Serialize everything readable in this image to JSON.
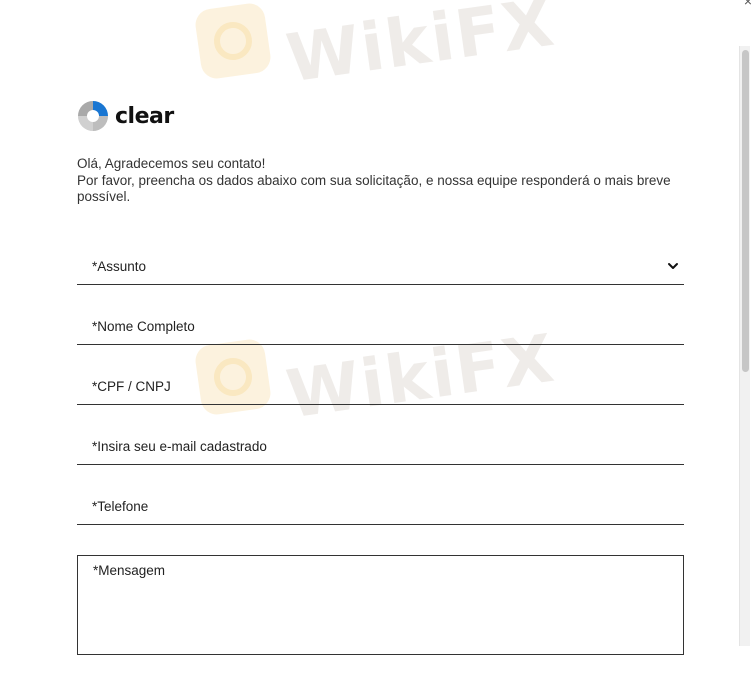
{
  "window": {
    "close_glyph": "×"
  },
  "watermark": {
    "text": "WikiFX"
  },
  "brand": {
    "name": "clear",
    "icon": "clear-logo-icon"
  },
  "intro": {
    "line1": "Olá, Agradecemos seu contato!",
    "line2": "Por favor, preencha os dados abaixo com sua solicitação, e nossa equipe responderá o mais breve possível."
  },
  "form": {
    "subject_label": "*Assunto",
    "name_label": "*Nome Completo",
    "document_label": "*CPF / CNPJ",
    "email_label": "*Insira seu e-mail cadastrado",
    "phone_label": "*Telefone",
    "message_label": "*Mensagem"
  },
  "colors": {
    "text": "#222222",
    "underline": "#333333",
    "watermark": "#e2ddd8",
    "brand_blue": "#1976d2"
  }
}
